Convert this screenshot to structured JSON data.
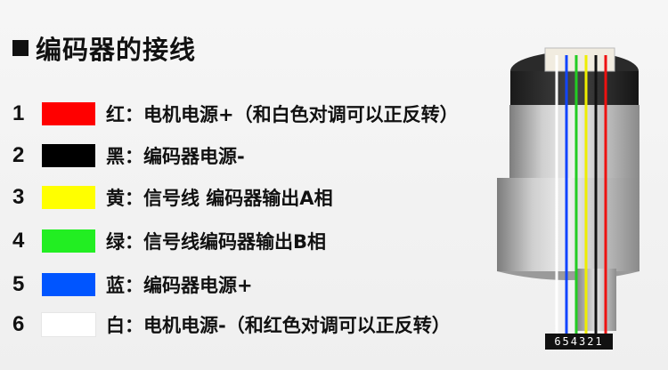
{
  "title": "编码器的接线",
  "wires": [
    {
      "num": "1",
      "color": "#ff0000",
      "label": "红：电机电源+（和白色对调可以正反转）"
    },
    {
      "num": "2",
      "color": "#000000",
      "label": "黑：编码器电源-"
    },
    {
      "num": "3",
      "color": "#ffff00",
      "label": "黄：信号线 编码器输出A相"
    },
    {
      "num": "4",
      "color": "#22ee22",
      "label": "绿：信号线编码器输出B相"
    },
    {
      "num": "5",
      "color": "#0055ff",
      "label": "蓝：编码器电源+"
    },
    {
      "num": "6",
      "color": "#ffffff",
      "label": "白：电机电源-（和红色对调可以正反转）"
    }
  ],
  "connector_label": "654321"
}
